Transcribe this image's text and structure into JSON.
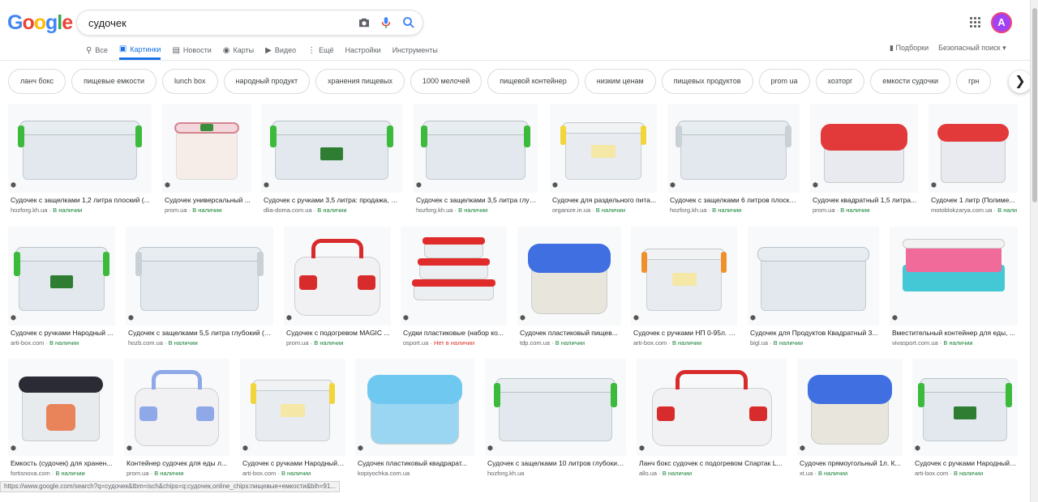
{
  "logo": [
    "G",
    "o",
    "o",
    "g",
    "l",
    "e"
  ],
  "search": {
    "value": "судочек",
    "placeholder": ""
  },
  "tabs": [
    {
      "label": "Все",
      "icon": "search-icon"
    },
    {
      "label": "Картинки",
      "icon": "image-icon"
    },
    {
      "label": "Новости",
      "icon": "news-icon"
    },
    {
      "label": "Карты",
      "icon": "map-pin-icon"
    },
    {
      "label": "Видео",
      "icon": "video-icon"
    },
    {
      "label": "Ещё",
      "icon": "more-vert-icon"
    },
    {
      "label": "Настройки",
      "icon": ""
    },
    {
      "label": "Инструменты",
      "icon": ""
    }
  ],
  "right_tools": {
    "collections": "Подборки",
    "safe_search": "Безопасный поиск"
  },
  "avatar": "A",
  "chips": [
    "ланч бокс",
    "пищевые емкости",
    "lunch box",
    "народный продукт",
    "хранения пищевых",
    "1000 мелочей",
    "пищевой контейнер",
    "низким ценам",
    "пищевых продуктов",
    "prom ua",
    "хозторг",
    "емкости судочки",
    "грн"
  ],
  "results": [
    {
      "title": "Судочек с защелками 1,2 литра плоский (...",
      "source": "hozforg.kh.ua",
      "stock": "В наличии",
      "in_stock": true
    },
    {
      "title": "Судочек универсальный ...",
      "source": "prom.ua",
      "stock": "В наличии",
      "in_stock": true
    },
    {
      "title": "Судочек с ручками 3,5 литра: продажа, це...",
      "source": "dlia-doma.com.ua",
      "stock": "В наличии",
      "in_stock": true
    },
    {
      "title": "Судочек с защелками 3,5 литра глубо...",
      "source": "hozforg.kh.ua",
      "stock": "В наличии",
      "in_stock": true
    },
    {
      "title": "Судочек для раздельного пита...",
      "source": "organize.in.ua",
      "stock": "В наличии",
      "in_stock": true
    },
    {
      "title": "Судочек с защелками 6 литров плоски...",
      "source": "hozforg.kh.ua",
      "stock": "В наличии",
      "in_stock": true
    },
    {
      "title": "Судочек квадратный 1,5 литра...",
      "source": "prom.ua",
      "stock": "В наличии",
      "in_stock": true
    },
    {
      "title": "Судочек 1 литр (Полиме...",
      "source": "motoblokzarya.com.ua",
      "stock": "В наличии",
      "in_stock": true
    },
    {
      "title": "Судочек с ручками Народный ...",
      "source": "arti-box.com",
      "stock": "В наличии",
      "in_stock": true
    },
    {
      "title": "Судочек с защелками 5,5 литра глубокий (Г...",
      "source": "hozb.com.ua",
      "stock": "В наличии",
      "in_stock": true
    },
    {
      "title": "Судочек с подогревом MAGIC ...",
      "source": "prom.ua",
      "stock": "В наличии",
      "in_stock": true
    },
    {
      "title": "Судки пластиковые (набор ко...",
      "source": "osport.ua",
      "stock": "Нет в наличии",
      "in_stock": false
    },
    {
      "title": "Судочек пластиковый пищев...",
      "source": "tdp.com.ua",
      "stock": "В наличии",
      "in_stock": true
    },
    {
      "title": "Судочек с ручками НП 0-95л. к...",
      "source": "arti-box.com",
      "stock": "В наличии",
      "in_stock": true
    },
    {
      "title": "Судочек для Продуктов Квадратный 3...",
      "source": "bigl.ua",
      "stock": "В наличии",
      "in_stock": true
    },
    {
      "title": "Вместительный контейнер для еды, ...",
      "source": "vivasport.com.ua",
      "stock": "В наличии",
      "in_stock": true
    },
    {
      "title": "Емкость (судочек) для хранен...",
      "source": "fortisnova.com",
      "stock": "В наличии",
      "in_stock": true
    },
    {
      "title": "Контейнер судочек для еды л...",
      "source": "prom.ua",
      "stock": "В наличии",
      "in_stock": true
    },
    {
      "title": "Судочек с ручками Народный ...",
      "source": "arti-box.com",
      "stock": "В наличии",
      "in_stock": true
    },
    {
      "title": "Судочек пластиковый квадрарат...",
      "source": "kopiyochka.com.ua",
      "stock": "",
      "in_stock": true
    },
    {
      "title": "Судочек с защелками 10 литров глубокий...",
      "source": "hozforg.kh.ua",
      "stock": "",
      "in_stock": true
    },
    {
      "title": "Ланч бокс судочек с подогревом Спартак L...",
      "source": "allo.ua",
      "stock": "В наличии",
      "in_stock": true
    },
    {
      "title": "Судочек прямоугольный 1л. К...",
      "source": "xt.ua",
      "stock": "В наличии",
      "in_stock": true
    },
    {
      "title": "Судочек с ручками Народный ...",
      "source": "arti-box.com",
      "stock": "В наличии",
      "in_stock": true
    }
  ],
  "status_url": "https://www.google.com/search?q=судочек&tbm=isch&chips=q:судочек,online_chips:пищевые+емкости&bih=91..."
}
